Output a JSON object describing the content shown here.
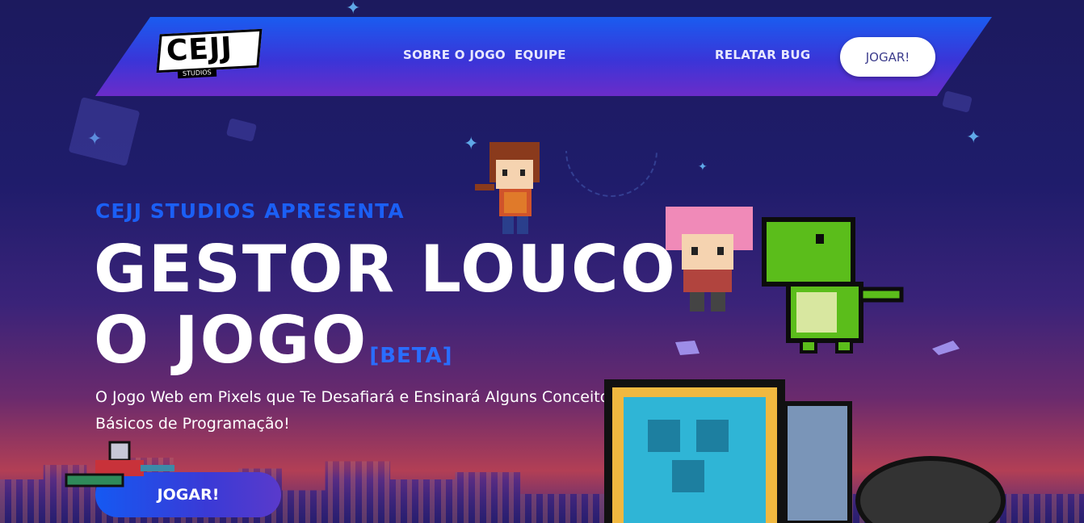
{
  "navbar": {
    "logo_text": "CEJJ",
    "logo_sub": "STUDIOS",
    "links": [
      "SOBRE O JOGO",
      "EQUIPE",
      "RELATAR BUG"
    ],
    "play_label": "JOGAR!"
  },
  "hero": {
    "eyebrow": "CEJJ STUDIOS APRESENTA",
    "title_line1": "GESTOR LOUCO:",
    "title_line2": "O JOGO",
    "badge": "[BETA]",
    "subtitle": "O Jogo Web em Pixels que Te Desafiará e Ensinará Alguns Conceitos Básicos de Programação!",
    "play_label": "JOGAR!"
  },
  "colors": {
    "nav_gradient_start": "#1a5cf0",
    "nav_gradient_end": "#6b2cc9",
    "accent_blue": "#1b5ff5",
    "button_text": "#3c3c8c"
  },
  "icons": [
    "cejj-logo",
    "girl-sprite",
    "pink-hair-sprite",
    "dinosaur-sprite",
    "knight-sprite",
    "cannon-sprite",
    "star-icon"
  ]
}
